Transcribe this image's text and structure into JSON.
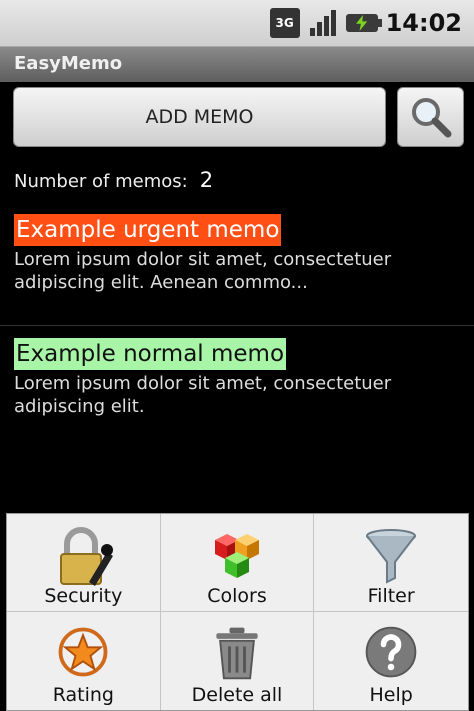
{
  "status_bar": {
    "network": "3G",
    "time": "14:02"
  },
  "app": {
    "title": "EasyMemo"
  },
  "toolbar": {
    "add_label": "ADD MEMO",
    "search_icon": "magnifier-icon"
  },
  "summary": {
    "count_label": "Number of memos:",
    "count_value": "2"
  },
  "memos": [
    {
      "title": "Example urgent memo",
      "body_line1": "Lorem ipsum dolor sit amet, consectetuer",
      "body_line2": "adipiscing elit. Aenean commo...",
      "highlight": "#ff4f14",
      "title_color": "#ffffff"
    },
    {
      "title": "Example normal memo",
      "body_line1": "Lorem ipsum dolor sit amet, consectetuer",
      "body_line2": "adipiscing elit.",
      "highlight": "#a8f5a8",
      "title_color": "#111111"
    }
  ],
  "menu": {
    "items": [
      {
        "label": "Security",
        "icon": "padlock-icon"
      },
      {
        "label": "Colors",
        "icon": "color-cubes-icon"
      },
      {
        "label": "Filter",
        "icon": "funnel-icon"
      },
      {
        "label": "Rating",
        "icon": "star-icon"
      },
      {
        "label": "Delete all",
        "icon": "trash-icon"
      },
      {
        "label": "Help",
        "icon": "help-icon"
      }
    ]
  }
}
